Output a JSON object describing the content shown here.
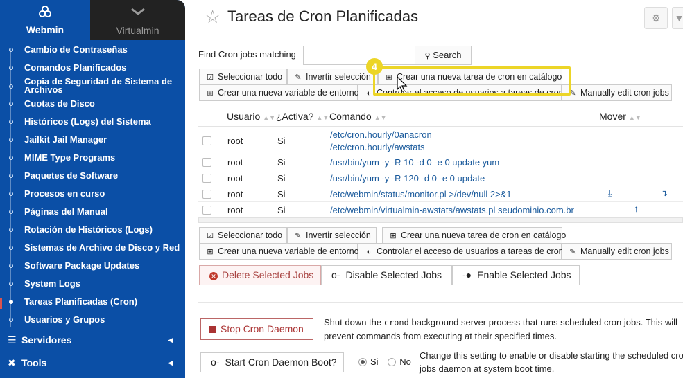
{
  "sidebar": {
    "tabs": [
      {
        "label": "Webmin",
        "icon": "webmin-logo-icon"
      },
      {
        "label": "Virtualmin",
        "icon": "virtualmin-chevron-icon"
      }
    ],
    "items": [
      {
        "label": "Cambio de Contraseñas"
      },
      {
        "label": "Comandos Planificados"
      },
      {
        "label": "Copia de Seguridad de Sistema de Archivos"
      },
      {
        "label": "Cuotas de Disco"
      },
      {
        "label": "Históricos (Logs) del Sistema"
      },
      {
        "label": "Jailkit Jail Manager"
      },
      {
        "label": "MIME Type Programs"
      },
      {
        "label": "Paquetes de Software"
      },
      {
        "label": "Procesos en curso"
      },
      {
        "label": "Páginas del Manual"
      },
      {
        "label": "Rotación de Históricos (Logs)"
      },
      {
        "label": "Sistemas de Archivo de Disco y Red"
      },
      {
        "label": "Software Package Updates"
      },
      {
        "label": "System Logs"
      },
      {
        "label": "Tareas Planificadas (Cron)",
        "active": true
      },
      {
        "label": "Usuarios y Grupos"
      }
    ],
    "categories": [
      {
        "label": "Servidores",
        "icon": "server-icon"
      },
      {
        "label": "Tools",
        "icon": "tools-icon"
      }
    ]
  },
  "header": {
    "title": "Tareas de Cron Planificadas"
  },
  "search": {
    "label": "Find Cron jobs matching",
    "value": "",
    "button": "Search"
  },
  "toolbar": {
    "select_all": "Seleccionar todo",
    "invert": "Invertir selección",
    "create_catalog": "Crear una nueva tarea de cron en catálogo",
    "create_env": "Crear una nueva variable de entorno",
    "access": "Controlar el acceso de usuarios a tareas de cron",
    "manual": "Manually edit cron jobs"
  },
  "annotation": {
    "step": "4",
    "color": "#ecd527"
  },
  "table": {
    "headers": {
      "user": "Usuario",
      "active": "¿Activa?",
      "command": "Comando",
      "move": "Mover"
    },
    "rows": [
      {
        "user": "root",
        "active": "Si",
        "command": [
          "/etc/cron.hourly/0anacron",
          "/etc/cron.hourly/awstats"
        ]
      },
      {
        "user": "root",
        "active": "Si",
        "command": [
          "/usr/bin/yum -y -R 10 -d 0 -e 0 update yum"
        ]
      },
      {
        "user": "root",
        "active": "Si",
        "command": [
          "/usr/bin/yum -y -R 120 -d 0 -e 0 update"
        ]
      },
      {
        "user": "root",
        "active": "Si",
        "command": [
          "/etc/webmin/status/monitor.pl >/dev/null 2>&1"
        ]
      },
      {
        "user": "root",
        "active": "Si",
        "command": [
          "/etc/webmin/virtualmin-awstats/awstats.pl seudominio.com.br"
        ]
      }
    ]
  },
  "actions": {
    "delete": "Delete Selected Jobs",
    "disable": "Disable Selected Jobs",
    "enable": "Enable Selected Jobs"
  },
  "daemon": {
    "stop_label": "Stop Cron Daemon",
    "stop_desc_before": "Shut down the ",
    "stop_desc_code": "crond",
    "stop_desc_after": " background server process that runs scheduled cron jobs. This will prevent commands from executing at their specified times.",
    "boot_label": "Start Cron Daemon Boot?",
    "boot_yes": "Si",
    "boot_no": "No",
    "boot_selected": "Si",
    "boot_desc": "Change this setting to enable or disable starting the scheduled cron jobs daemon at system boot time."
  }
}
